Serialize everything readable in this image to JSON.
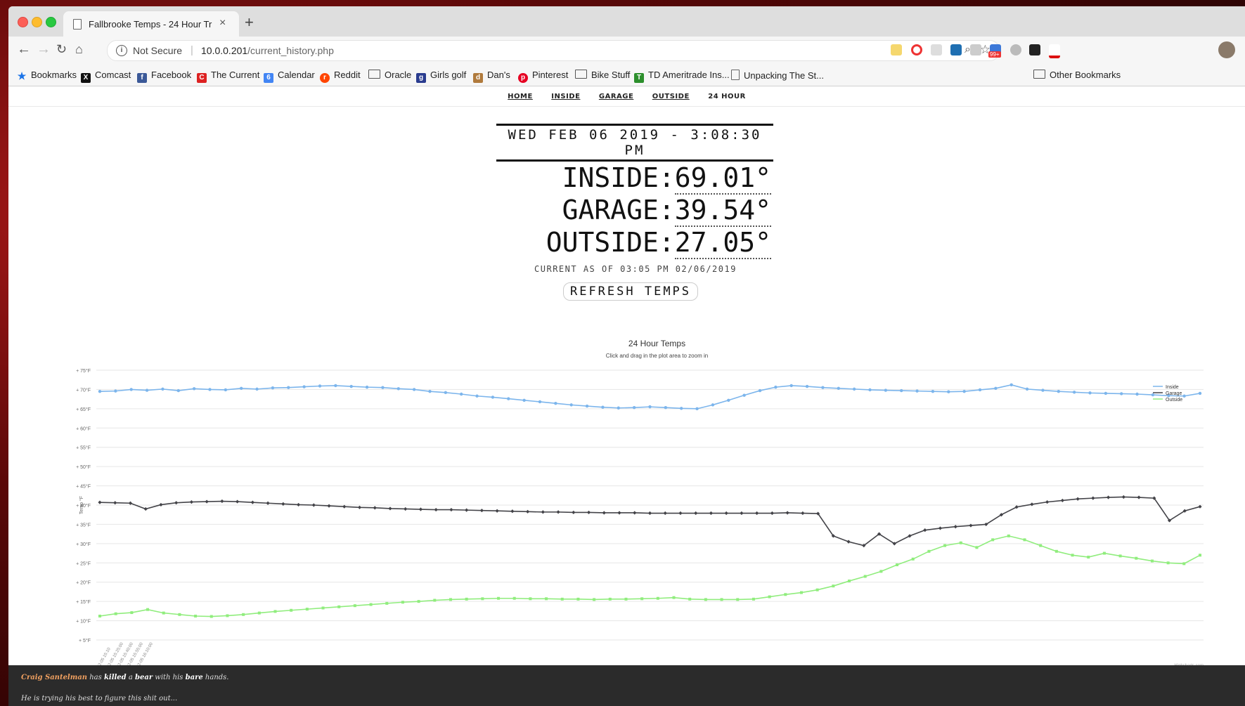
{
  "browser": {
    "tab_title": "Fallbrooke Temps - 24 Hour Tr",
    "security_label": "Not Secure",
    "url_host": "10.0.0.201",
    "url_path": "/current_history.php",
    "ext_badge": "99+"
  },
  "bookmarks": [
    {
      "label": "Bookmarks",
      "icon": "star-icon"
    },
    {
      "label": "Comcast",
      "icon": "x-icon"
    },
    {
      "label": "Facebook",
      "icon": "facebook-icon"
    },
    {
      "label": "The Current",
      "icon": "current-icon"
    },
    {
      "label": "Calendar",
      "icon": "calendar-icon"
    },
    {
      "label": "Reddit",
      "icon": "reddit-icon"
    },
    {
      "label": "Oracle",
      "icon": "folder-icon"
    },
    {
      "label": "Girls golf",
      "icon": "golf-icon"
    },
    {
      "label": "Dan's",
      "icon": "dans-icon"
    },
    {
      "label": "Pinterest",
      "icon": "pinterest-icon"
    },
    {
      "label": "Bike Stuff",
      "icon": "folder-icon"
    },
    {
      "label": "TD Ameritrade Ins...",
      "icon": "td-icon"
    },
    {
      "label": "Unpacking The St...",
      "icon": "page-icon"
    },
    {
      "label": "Other Bookmarks",
      "icon": "folder-icon"
    }
  ],
  "site_nav": [
    "HOME",
    "INSIDE",
    "GARAGE",
    "OUTSIDE",
    "24 HOUR"
  ],
  "readings": {
    "datetime": "WED FEB 06 2019 - 3:08:30 PM",
    "inside_label": "INSIDE:",
    "inside_value": "69.01°",
    "garage_label": "GARAGE:",
    "garage_value": "39.54°",
    "outside_label": "OUTSIDE:",
    "outside_value": "27.05°",
    "as_of": "CURRENT AS OF 03:05 PM 02/06/2019",
    "refresh_label": "REFRESH TEMPS"
  },
  "chart_data": {
    "type": "line",
    "title": "24 Hour Temps",
    "subtitle": "Click and drag in the plot area to zoom in",
    "ylabel": "Temp °F",
    "ylim": [
      5,
      75
    ],
    "yticks": [
      "+ 75°F",
      "+ 70°F",
      "+ 65°F",
      "+ 60°F",
      "+ 55°F",
      "+ 50°F",
      "+ 45°F",
      "+ 40°F",
      "+ 35°F",
      "+ 30°F",
      "+ 25°F",
      "+ 20°F",
      "+ 15°F",
      "+ 10°F",
      "+ 5°F"
    ],
    "x_sample_labels": [
      "02-05 15:10",
      "02-05 15:25:00",
      "02-05 15:40:00",
      "02-05 15:55:00",
      "02-05 16:10:00"
    ],
    "legend_position": "right",
    "credit": "Highcharts.com",
    "series": [
      {
        "name": "Inside",
        "color": "#7cb5ec",
        "marker": "circle",
        "values": [
          69.5,
          69.6,
          70.0,
          69.8,
          70.1,
          69.7,
          70.2,
          70.0,
          69.9,
          70.3,
          70.1,
          70.4,
          70.5,
          70.7,
          70.9,
          71.0,
          70.8,
          70.6,
          70.5,
          70.2,
          70.0,
          69.5,
          69.2,
          68.8,
          68.3,
          68.0,
          67.6,
          67.2,
          66.8,
          66.4,
          66.0,
          65.7,
          65.4,
          65.2,
          65.3,
          65.5,
          65.3,
          65.1,
          65.0,
          66.0,
          67.2,
          68.5,
          69.7,
          70.6,
          71.0,
          70.8,
          70.5,
          70.3,
          70.1,
          69.9,
          69.8,
          69.7,
          69.6,
          69.5,
          69.4,
          69.5,
          69.9,
          70.3,
          71.2,
          70.1,
          69.8,
          69.5,
          69.3,
          69.1,
          69.0,
          68.9,
          68.8,
          68.6,
          68.4,
          68.3,
          69.0
        ]
      },
      {
        "name": "Garage",
        "color": "#434348",
        "marker": "diamond",
        "values": [
          40.7,
          40.6,
          40.5,
          39.0,
          40.1,
          40.6,
          40.8,
          40.9,
          41.0,
          40.9,
          40.7,
          40.5,
          40.3,
          40.1,
          40.0,
          39.8,
          39.6,
          39.4,
          39.3,
          39.1,
          39.0,
          38.9,
          38.8,
          38.8,
          38.7,
          38.6,
          38.5,
          38.4,
          38.3,
          38.2,
          38.2,
          38.1,
          38.1,
          38.0,
          38.0,
          38.0,
          37.9,
          37.9,
          37.9,
          37.9,
          37.9,
          37.9,
          37.9,
          37.9,
          37.9,
          38.0,
          37.9,
          37.8,
          32.0,
          30.5,
          29.5,
          32.5,
          30.0,
          32.0,
          33.5,
          34.0,
          34.4,
          34.7,
          35.0,
          37.5,
          39.5,
          40.2,
          40.8,
          41.2,
          41.6,
          41.8,
          42.0,
          42.1,
          42.0,
          41.8,
          36.0,
          38.5,
          39.6
        ]
      },
      {
        "name": "Outside",
        "color": "#90ed7d",
        "marker": "square",
        "values": [
          11.2,
          11.8,
          12.1,
          12.9,
          12.0,
          11.6,
          11.2,
          11.1,
          11.3,
          11.6,
          12.0,
          12.4,
          12.7,
          13.0,
          13.3,
          13.6,
          13.9,
          14.2,
          14.5,
          14.8,
          15.0,
          15.3,
          15.5,
          15.6,
          15.7,
          15.8,
          15.8,
          15.7,
          15.7,
          15.6,
          15.6,
          15.5,
          15.6,
          15.6,
          15.7,
          15.8,
          16.0,
          15.6,
          15.5,
          15.5,
          15.5,
          15.6,
          16.2,
          16.8,
          17.3,
          18.0,
          19.0,
          20.3,
          21.5,
          22.8,
          24.5,
          26.0,
          28.0,
          29.5,
          30.2,
          29.0,
          31.0,
          32.0,
          31.0,
          29.5,
          28.0,
          27.0,
          26.5,
          27.5,
          26.8,
          26.2,
          25.5,
          25.0,
          24.8,
          27.0
        ]
      }
    ]
  },
  "footer": {
    "name": "Craig Santelman",
    "t1": " has ",
    "w1": "killed",
    "t2": " a ",
    "w2": "bear",
    "t3": " with his ",
    "w3": "bare",
    "t4": " hands.",
    "line2": "He is trying his best to figure this shit out..."
  }
}
